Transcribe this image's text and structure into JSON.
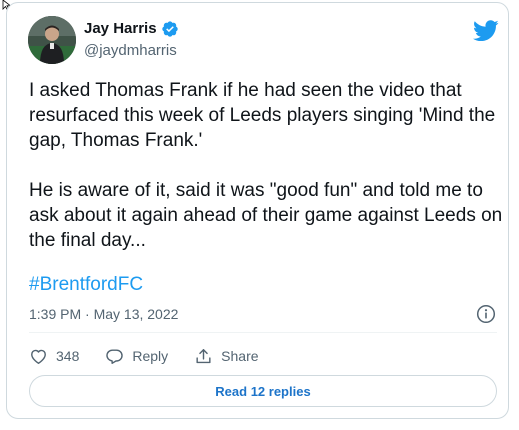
{
  "author": {
    "display_name": "Jay Harris",
    "handle": "@jaydmharris",
    "verified": true,
    "avatar_icon": "profile-photo"
  },
  "tweet": {
    "paragraphs": [
      "I asked Thomas Frank if he had seen the video that resurfaced this week of Leeds players singing 'Mind the gap, Thomas Frank.'",
      "He is aware of it, said it was \"good fun\" and told me to ask about it again ahead of their game against Leeds on the final day..."
    ],
    "hashtag": "#BrentfordFC",
    "timestamp": "1:39 PM · May 13, 2022"
  },
  "actions": {
    "like_count": "348",
    "reply_label": "Reply",
    "share_label": "Share"
  },
  "read_replies_label": "Read 12 replies",
  "colors": {
    "brand_blue": "#1d9bf0",
    "link_blue": "#1d74c9",
    "text_primary": "#0f1419",
    "text_secondary": "#536471",
    "border": "#cfd9de"
  },
  "icons": {
    "brand": "twitter-bird-icon",
    "verified": "verified-badge-icon",
    "info": "info-icon",
    "like": "heart-icon",
    "reply": "speech-bubble-icon",
    "share": "share-upload-icon"
  }
}
